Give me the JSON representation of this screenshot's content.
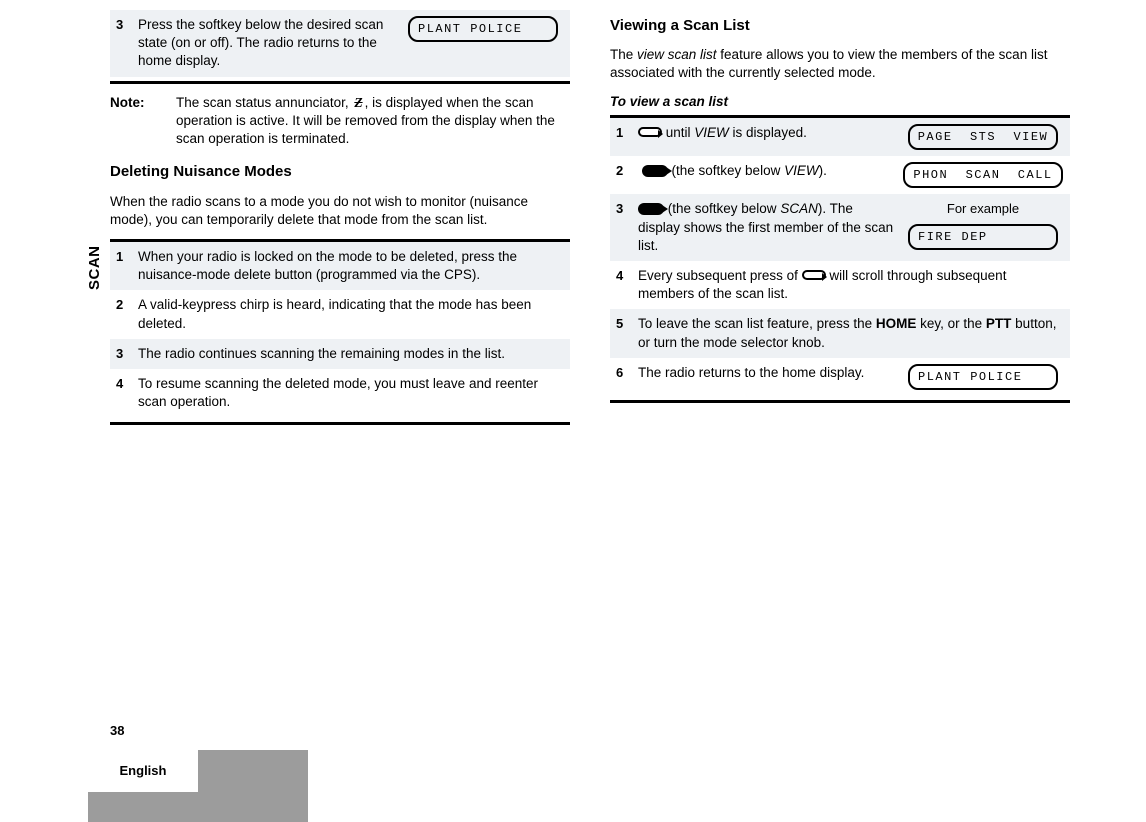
{
  "sideTab": "SCAN",
  "pageNumber": "38",
  "language": "English",
  "left": {
    "step3": {
      "num": "3",
      "text": "Press the softkey below the desired scan state (on or off). The radio returns to the home display.",
      "lcd": "PLANT POLICE"
    },
    "note": {
      "label": "Note:",
      "text1": "The scan status annunciator, ",
      "text2": ", is dis­played when the scan operation is active. It will be removed from the display when the scan operation is terminated."
    },
    "heading1": "Deleting Nuisance Modes",
    "body1": "When the radio scans to a mode you do not wish to monitor (nuisance mode), you can temporarily delete that mode from the scan list.",
    "steps": {
      "s1": {
        "num": "1",
        "text": "When your radio is locked on the mode to be deleted, press the nuisance-mode delete button (programmed via the CPS)."
      },
      "s2": {
        "num": "2",
        "text": "A valid-keypress chirp is heard, indicating that the mode has been deleted."
      },
      "s3": {
        "num": "3",
        "text": "The radio continues scanning the remaining modes in the list."
      },
      "s4": {
        "num": "4",
        "text": "To resume scanning the deleted mode, you must leave and reenter scan operation."
      }
    }
  },
  "right": {
    "heading": "Viewing a Scan List",
    "body_a": "The ",
    "body_italic": "view scan list",
    "body_b": " feature allows you to view the members of the scan list associated with the currently selected mode.",
    "procTitle": "To view a scan list",
    "s1": {
      "num": "1",
      "text_a": " until ",
      "text_italic": "VIEW",
      "text_b": " is displayed.",
      "lcd": "PAGE  STS  VIEW"
    },
    "s2": {
      "num": "2",
      "text_a": " (the softkey below ",
      "text_italic": "VIEW",
      "text_b": ").",
      "lcd": "PHON  SCAN  CALL"
    },
    "s3": {
      "num": "3",
      "text_a": " (the softkey below ",
      "text_italic": "SCAN",
      "text_b": "). The display shows the first member of the scan list.",
      "forExample": "For example",
      "lcd": "FIRE DEP"
    },
    "s4": {
      "num": "4",
      "text_a": "Every subsequent press of ",
      "text_b": " will scroll through subsequent members of the scan list."
    },
    "s5": {
      "num": "5",
      "text_a": "To leave the scan list feature, press the ",
      "home": "HOME",
      "text_b": " key, or the ",
      "ptt": "PTT",
      "text_c": " button, or turn the mode selector knob."
    },
    "s6": {
      "num": "6",
      "text": "The radio returns to the home display.",
      "lcd": "PLANT POLICE"
    }
  }
}
